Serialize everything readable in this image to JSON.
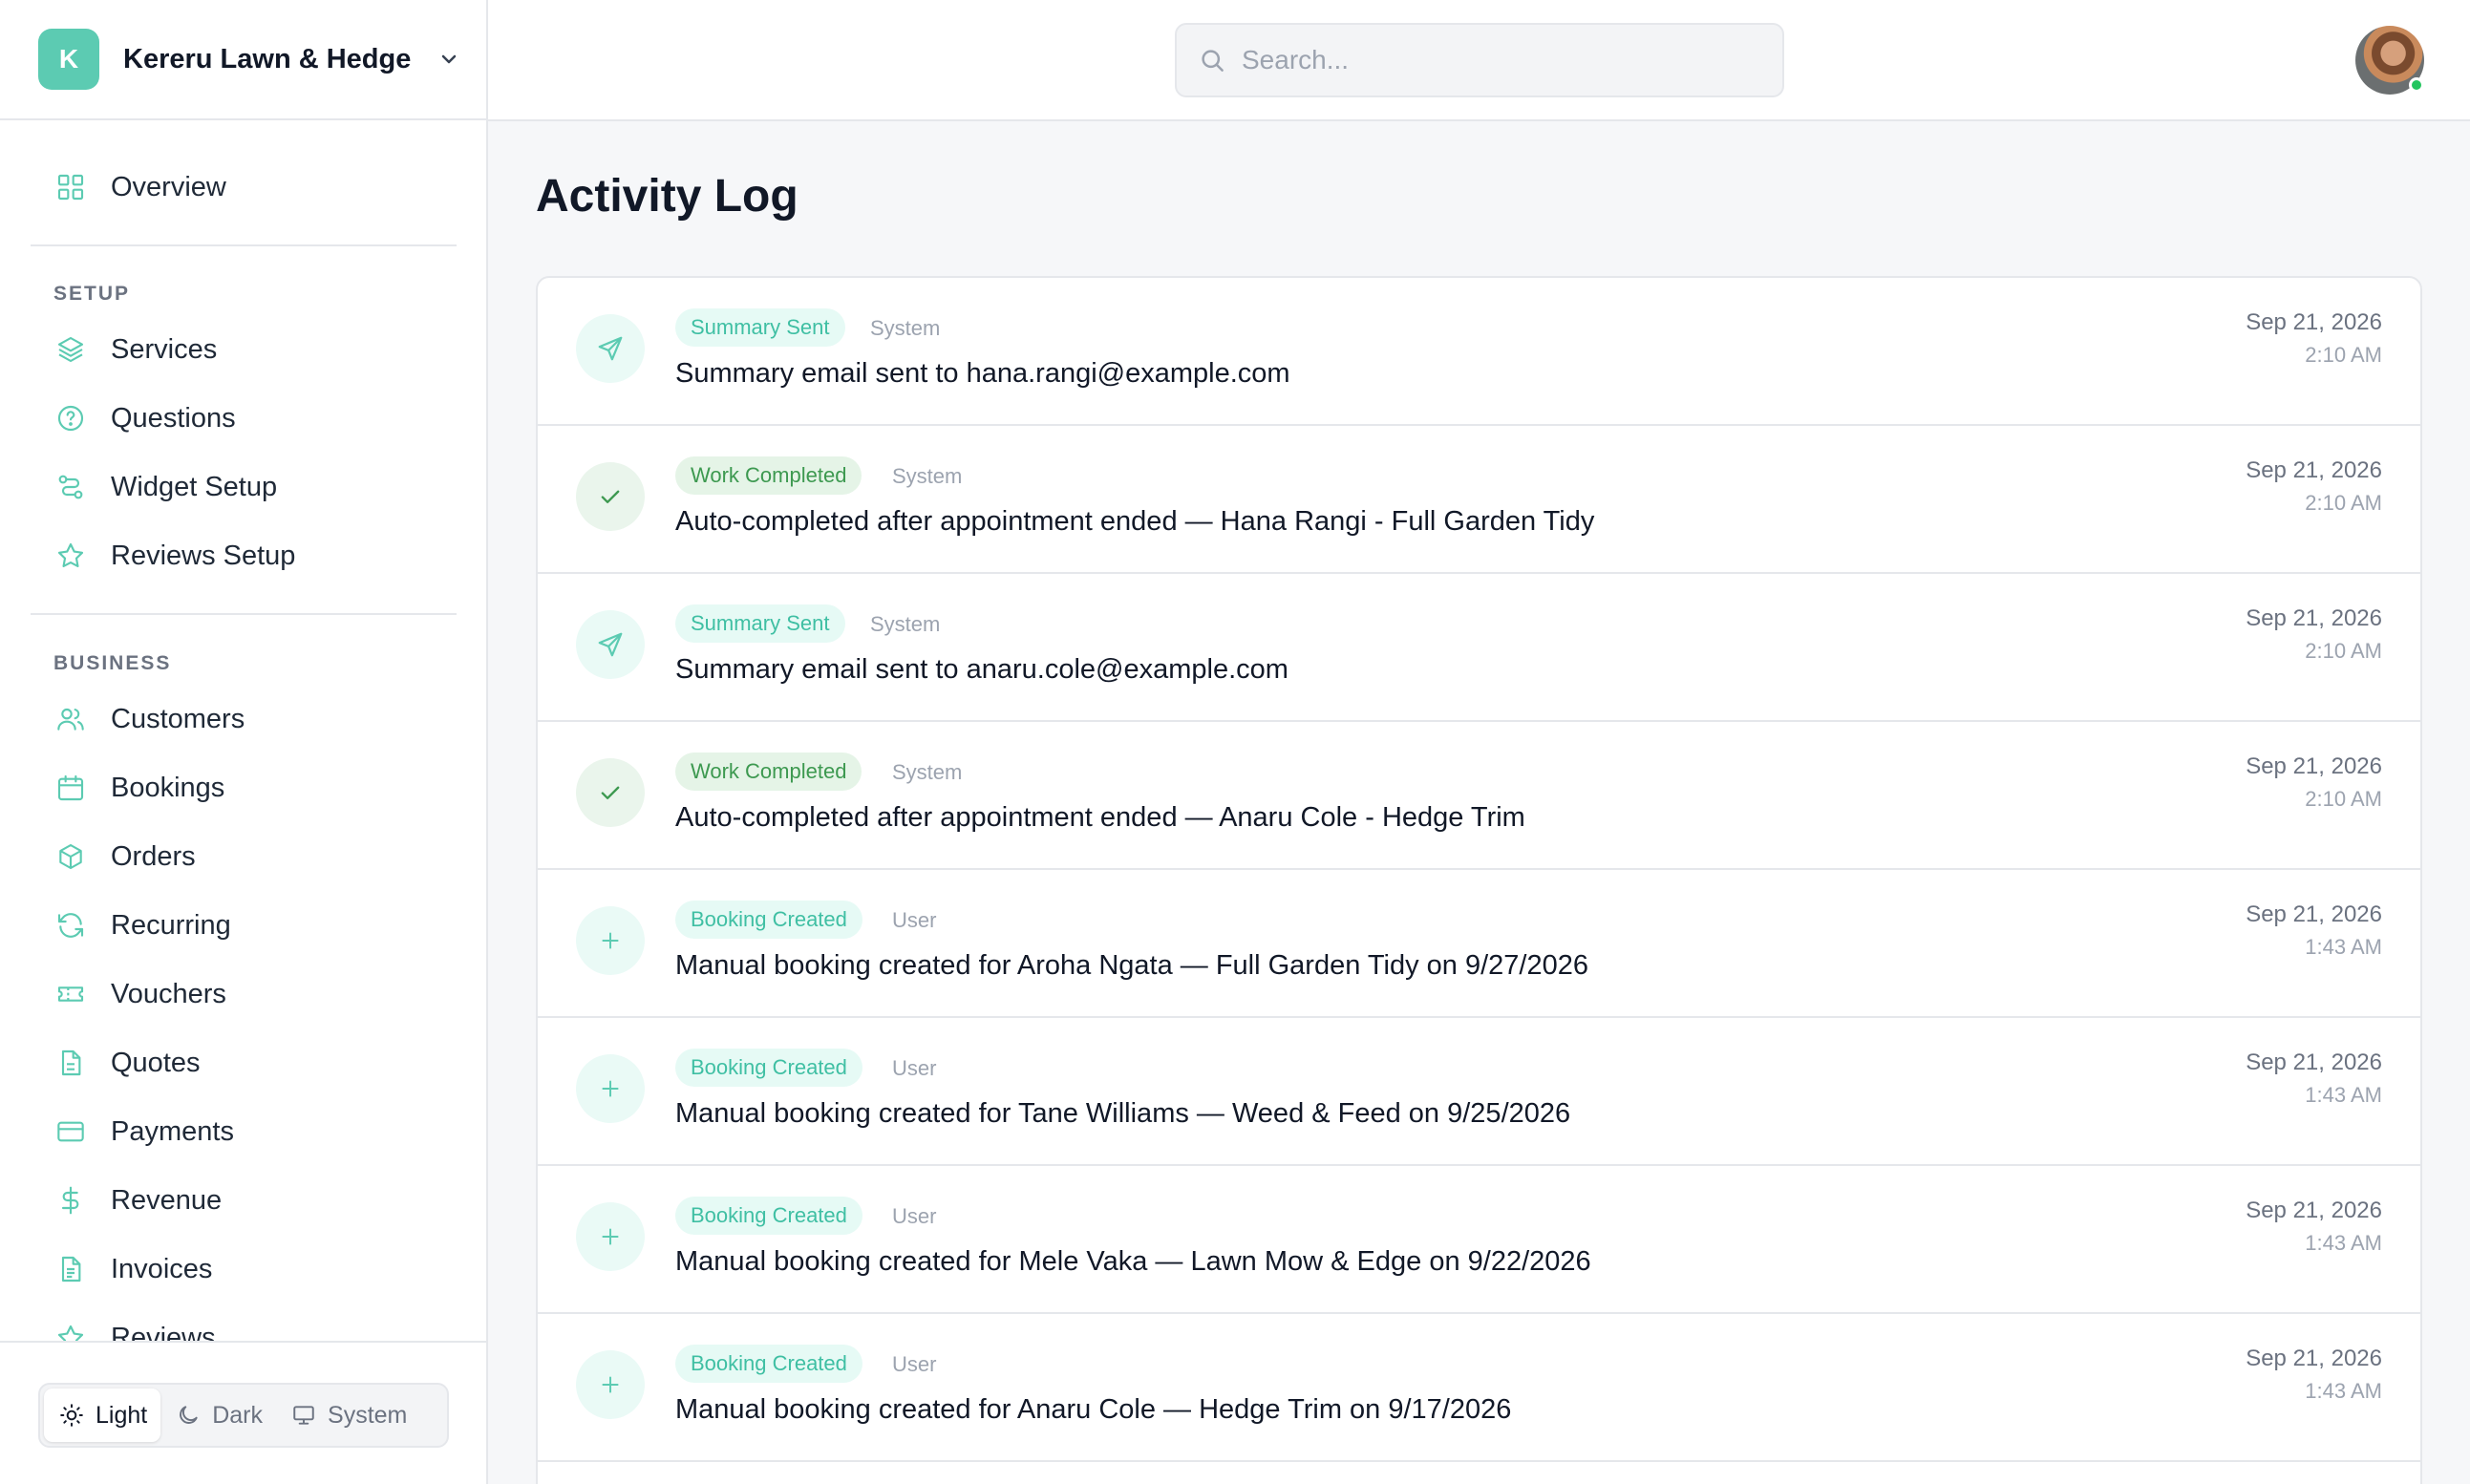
{
  "brand": {
    "initial": "K",
    "name": "Kereru Lawn & Hedge"
  },
  "search": {
    "placeholder": "Search..."
  },
  "nav": {
    "overview": "Overview",
    "setup_title": "SETUP",
    "setup": [
      "Services",
      "Questions",
      "Widget Setup",
      "Reviews Setup"
    ],
    "business_title": "BUSINESS",
    "business": [
      "Customers",
      "Bookings",
      "Orders",
      "Recurring",
      "Vouchers",
      "Quotes",
      "Payments",
      "Revenue",
      "Invoices",
      "Reviews"
    ]
  },
  "theme": {
    "light": "Light",
    "dark": "Dark",
    "system": "System",
    "selected": "Light"
  },
  "page": {
    "title": "Activity Log"
  },
  "colors": {
    "accent": "#5ccbb2",
    "teal_badge_text": "#3fbfa3",
    "green_badge_text": "#3d9950",
    "online": "#22c55e"
  },
  "activity": [
    {
      "type": "Summary Sent",
      "tone": "teal",
      "icon": "send-icon",
      "actor": "System",
      "text": "Summary email sent to hana.rangi@example.com",
      "date": "Sep 21, 2026",
      "time": "2:10 AM"
    },
    {
      "type": "Work Completed",
      "tone": "green",
      "icon": "check-icon",
      "actor": "System",
      "text": "Auto-completed after appointment ended — Hana Rangi - Full Garden Tidy",
      "date": "Sep 21, 2026",
      "time": "2:10 AM"
    },
    {
      "type": "Summary Sent",
      "tone": "teal",
      "icon": "send-icon",
      "actor": "System",
      "text": "Summary email sent to anaru.cole@example.com",
      "date": "Sep 21, 2026",
      "time": "2:10 AM"
    },
    {
      "type": "Work Completed",
      "tone": "green",
      "icon": "check-icon",
      "actor": "System",
      "text": "Auto-completed after appointment ended — Anaru Cole - Hedge Trim",
      "date": "Sep 21, 2026",
      "time": "2:10 AM"
    },
    {
      "type": "Booking Created",
      "tone": "teal",
      "icon": "plus-icon",
      "actor": "User",
      "text": "Manual booking created for Aroha Ngata — Full Garden Tidy on 9/27/2026",
      "date": "Sep 21, 2026",
      "time": "1:43 AM"
    },
    {
      "type": "Booking Created",
      "tone": "teal",
      "icon": "plus-icon",
      "actor": "User",
      "text": "Manual booking created for Tane Williams — Weed & Feed on 9/25/2026",
      "date": "Sep 21, 2026",
      "time": "1:43 AM"
    },
    {
      "type": "Booking Created",
      "tone": "teal",
      "icon": "plus-icon",
      "actor": "User",
      "text": "Manual booking created for Mele Vaka — Lawn Mow & Edge on 9/22/2026",
      "date": "Sep 21, 2026",
      "time": "1:43 AM"
    },
    {
      "type": "Booking Created",
      "tone": "teal",
      "icon": "plus-icon",
      "actor": "User",
      "text": "Manual booking created for Anaru Cole — Hedge Trim on 9/17/2026",
      "date": "Sep 21, 2026",
      "time": "1:43 AM"
    }
  ]
}
